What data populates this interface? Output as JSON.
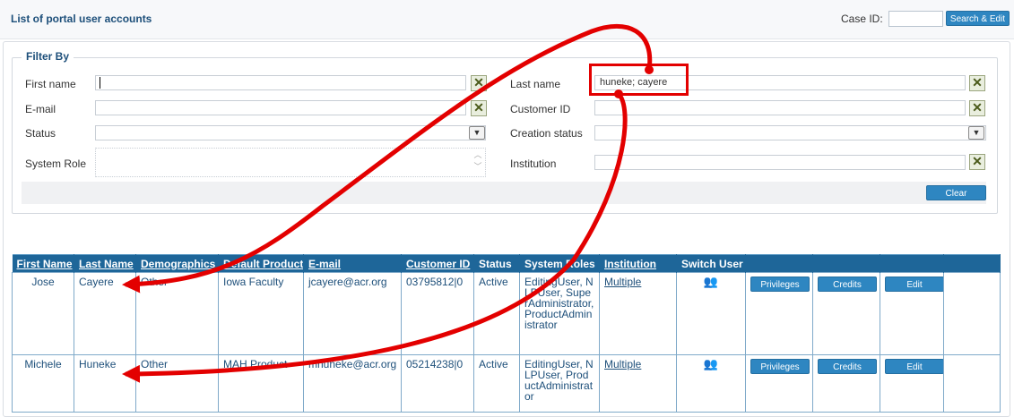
{
  "header": {
    "title": "List of portal user accounts",
    "case_id_label": "Case ID:",
    "search_edit_label": "Search & Edit"
  },
  "filter": {
    "legend": "Filter By",
    "first_name_label": "First name",
    "last_name_label": "Last name",
    "last_name_value": "huneke; cayere",
    "email_label": "E-mail",
    "customer_id_label": "Customer ID",
    "status_label": "Status",
    "creation_status_label": "Creation status",
    "system_role_label": "System Role",
    "institution_label": "Institution",
    "clear_label": "Clear"
  },
  "table": {
    "headers": [
      "First Name",
      "Last Name",
      "Demographics",
      "Default Product",
      "E-mail",
      "Customer ID",
      "Status",
      "System Roles",
      "Institution",
      "Switch User"
    ],
    "rows": [
      {
        "first_name": "Jose",
        "last_name": "Cayere",
        "demographics": "Other",
        "product": "Iowa Faculty",
        "email": "jcayere@acr.org",
        "customer_id": "03795812|0",
        "status": "Active",
        "roles": "EditingUser, NLPUser, SuperAdministrator, ProductAdministrator",
        "institution": "Multiple",
        "switch_icon": "switch-user-icon",
        "privileges": "Privileges",
        "credits": "Credits",
        "edit": "Edit"
      },
      {
        "first_name": "Michele",
        "last_name": "Huneke",
        "demographics": "Other",
        "product": "MAH Product",
        "email": "mhuneke@acr.org",
        "customer_id": "05214238|0",
        "status": "Active",
        "roles": "EditingUser, NLPUser, ProductAdministrator",
        "institution": "Multiple",
        "switch_icon": "switch-user-icon",
        "privileges": "Privileges",
        "credits": "Credits",
        "edit": "Edit"
      }
    ]
  },
  "colors": {
    "accent": "#1e6699",
    "button": "#2e86c1",
    "annotation": "#e30000"
  }
}
